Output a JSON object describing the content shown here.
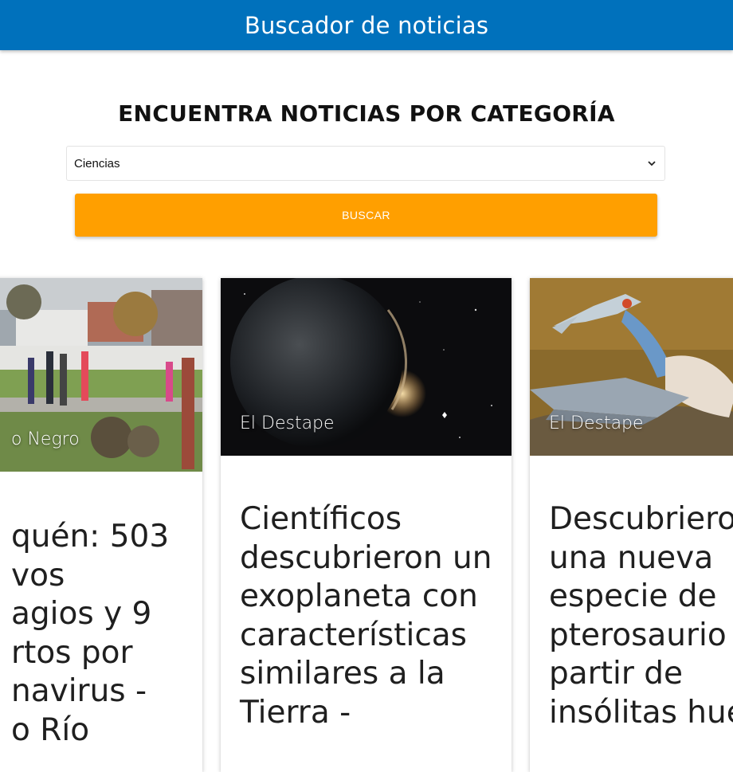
{
  "navbar": {
    "title": "Buscador de noticias"
  },
  "search": {
    "heading": "ENCUENTRA NOTICIAS POR CATEGORÍA",
    "selected_category": "Ciencias",
    "button_label": "BUSCAR"
  },
  "colors": {
    "navbar": "#0071bc",
    "button": "#ff9f00"
  },
  "cards": [
    {
      "source": "o Negro",
      "title_lines": [
        "quén: 503",
        "vos",
        "agios y 9",
        "rtos por",
        "navirus -",
        "o Río"
      ]
    },
    {
      "source": "El Destape",
      "title_lines": [
        "Científicos",
        "descubrieron un",
        "exoplaneta con",
        "características",
        "similares a la",
        "Tierra -"
      ]
    },
    {
      "source": "El Destape",
      "title_lines": [
        "Descubriero",
        "una nueva",
        "especie de",
        "pterosaurio",
        "partir de",
        "insólitas hue"
      ]
    }
  ]
}
